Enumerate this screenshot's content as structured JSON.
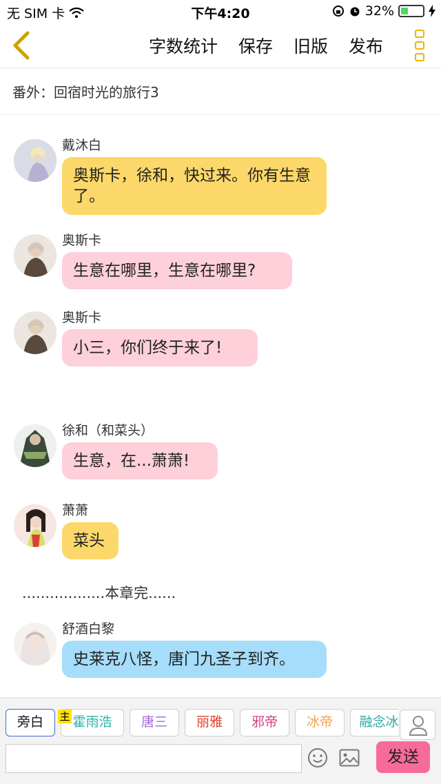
{
  "status_bar": {
    "carrier": "无 SIM 卡",
    "time": "下午4:20",
    "battery": "32%",
    "battery_level": 0.32
  },
  "nav": {
    "items": [
      "字数统计",
      "保存",
      "旧版",
      "发布"
    ]
  },
  "chapter_title": "番外：回宿时光的旅行3",
  "messages": [
    {
      "name": "戴沐白",
      "text": "奥斯卡，徐和，快过来。你有生意了。",
      "color": "yellow"
    },
    {
      "name": "奥斯卡",
      "text": "生意在哪里，生意在哪里?",
      "color": "pink"
    },
    {
      "name": "奥斯卡",
      "text": "小三，你们终于来了!",
      "color": "pink"
    },
    {
      "name": "徐和（和菜头）",
      "text": "生意，在...萧萧!",
      "color": "pink"
    },
    {
      "name": "萧萧",
      "text": "菜头",
      "color": "yellow"
    },
    {
      "name": "舒酒白黎",
      "text": "史莱克八怪，唐门九圣子到齐。",
      "color": "blue"
    }
  ],
  "narration": "..................本章完......",
  "characters": [
    {
      "label": "旁白",
      "color": "#111111"
    },
    {
      "label": "霍雨浩",
      "color": "#28b5a8"
    },
    {
      "label": "唐三",
      "color": "#a86ad8"
    },
    {
      "label": "丽雅",
      "color": "#e0402a"
    },
    {
      "label": "邪帝",
      "color": "#d63a86"
    },
    {
      "label": "冰帝",
      "color": "#f2a24a"
    },
    {
      "label": "融念冰",
      "color": "#2aa9a0"
    }
  ],
  "main_badge": "主",
  "input": {
    "value": "",
    "placeholder": ""
  },
  "send_label": "发送"
}
